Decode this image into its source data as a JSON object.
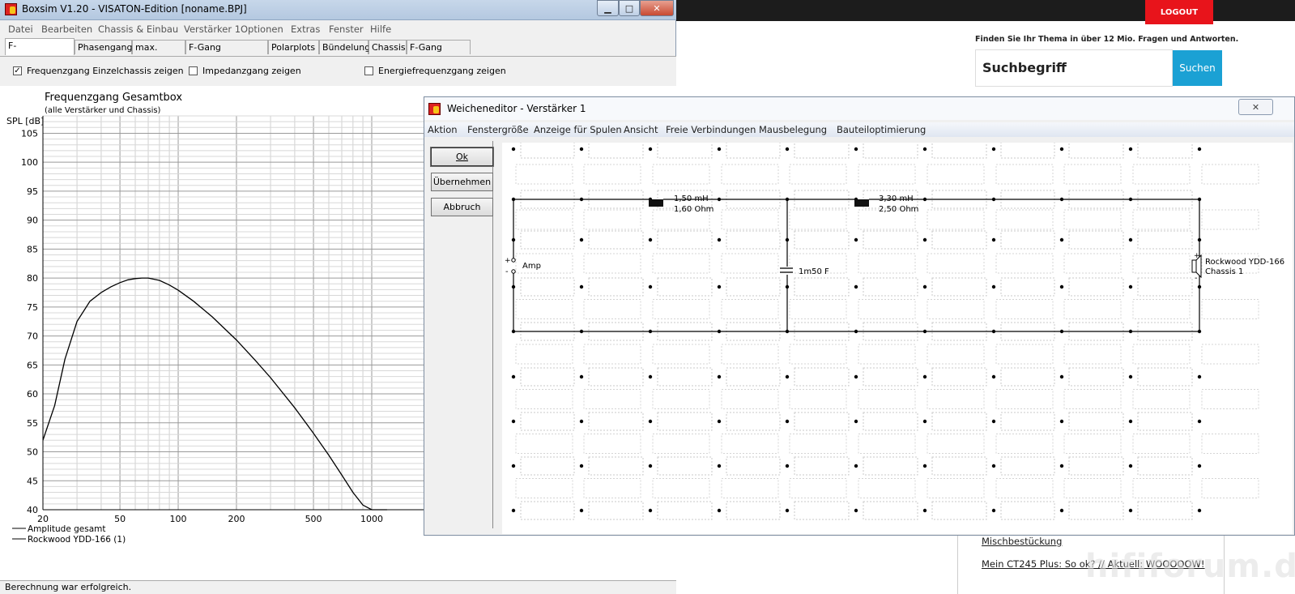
{
  "web": {
    "logout": "LOGOUT",
    "tagline": "Finden Sie Ihr Thema in über 12 Mio. Fragen und Antworten.",
    "search_value": "Suchbegriff",
    "search_button": "Suchen",
    "links": [
      "Mischbestückung",
      "Mein CT245 Plus: So ok? // Aktuell: WOOOOOW!"
    ],
    "watermark": "hififorum.de"
  },
  "boxsim": {
    "title": "Boxsim V1.20 - VISATON-Edition [noname.BPJ]",
    "menu": [
      "Datei",
      "Bearbeiten",
      "Chassis & Einbau",
      "Verstärker 1",
      "Optionen",
      "Extras",
      "Fenster",
      "Hilfe"
    ],
    "tabs": [
      "F-Gang/Imped.",
      "Phasengang",
      "max. Pegel",
      "F-Gang Richtungen",
      "Polarplots",
      "Bündelung",
      "Chassis",
      "F-Gang elektr."
    ],
    "active_tab": 0,
    "checkboxes": [
      {
        "label": "Frequenzgang Einzelchassis zeigen",
        "checked": true
      },
      {
        "label": "Impedanzgang zeigen",
        "checked": false
      },
      {
        "label": "Energiefrequenzgang zeigen",
        "checked": false
      }
    ],
    "status": "Berechnung war erfolgreich."
  },
  "chart_data": {
    "type": "line",
    "title": "Frequenzgang Gesamtbox",
    "subtitle": "(alle Verstärker und Chassis)",
    "ylabel": "SPL [dB]",
    "xlabel": "",
    "x_scale": "log",
    "xlim": [
      20,
      1000
    ],
    "ylim": [
      40,
      108
    ],
    "grid": true,
    "x_ticks": [
      20,
      50,
      100,
      200,
      500,
      1000
    ],
    "y_ticks": [
      40,
      45,
      50,
      55,
      60,
      65,
      70,
      75,
      80,
      85,
      90,
      95,
      100,
      105
    ],
    "legend": [
      "Amplitude gesamt",
      "Rockwood YDD-166 (1)"
    ],
    "legend_position": "bottom-left",
    "series": [
      {
        "name": "Amplitude gesamt",
        "x": [
          20,
          23,
          26,
          30,
          35,
          40,
          45,
          50,
          55,
          60,
          65,
          70,
          80,
          90,
          100,
          120,
          150,
          200,
          250,
          300,
          400,
          500,
          600,
          700,
          800,
          900,
          1000,
          1100,
          1200
        ],
        "y": [
          52,
          58,
          66,
          72.5,
          76,
          77.5,
          78.5,
          79.2,
          79.7,
          79.9,
          80,
          80,
          79.6,
          78.8,
          77.9,
          76,
          73.3,
          69.3,
          65.8,
          62.8,
          57.6,
          53.2,
          49.4,
          46,
          43,
          40.8,
          40,
          40,
          40
        ]
      }
    ]
  },
  "weiche": {
    "title": "Weicheneditor - Verstärker 1",
    "menu": [
      "Aktion",
      "Fenstergröße",
      "Anzeige für Spulen",
      "Ansicht",
      "Freie Verbindungen",
      "Mausbelegung",
      "Bauteiloptimierung"
    ],
    "buttons": [
      "Ok",
      "Übernehmen",
      "Abbruch"
    ],
    "components": {
      "coil1": [
        "1,50 mH",
        "1,60 Ohm"
      ],
      "coil2": [
        "3,30 mH",
        "2,50 Ohm"
      ],
      "cap": "1m50 F",
      "amp": "Amp",
      "speaker": [
        "Rockwood YDD-166",
        "Chassis 1"
      ],
      "plus": "+",
      "minus": "-"
    }
  }
}
